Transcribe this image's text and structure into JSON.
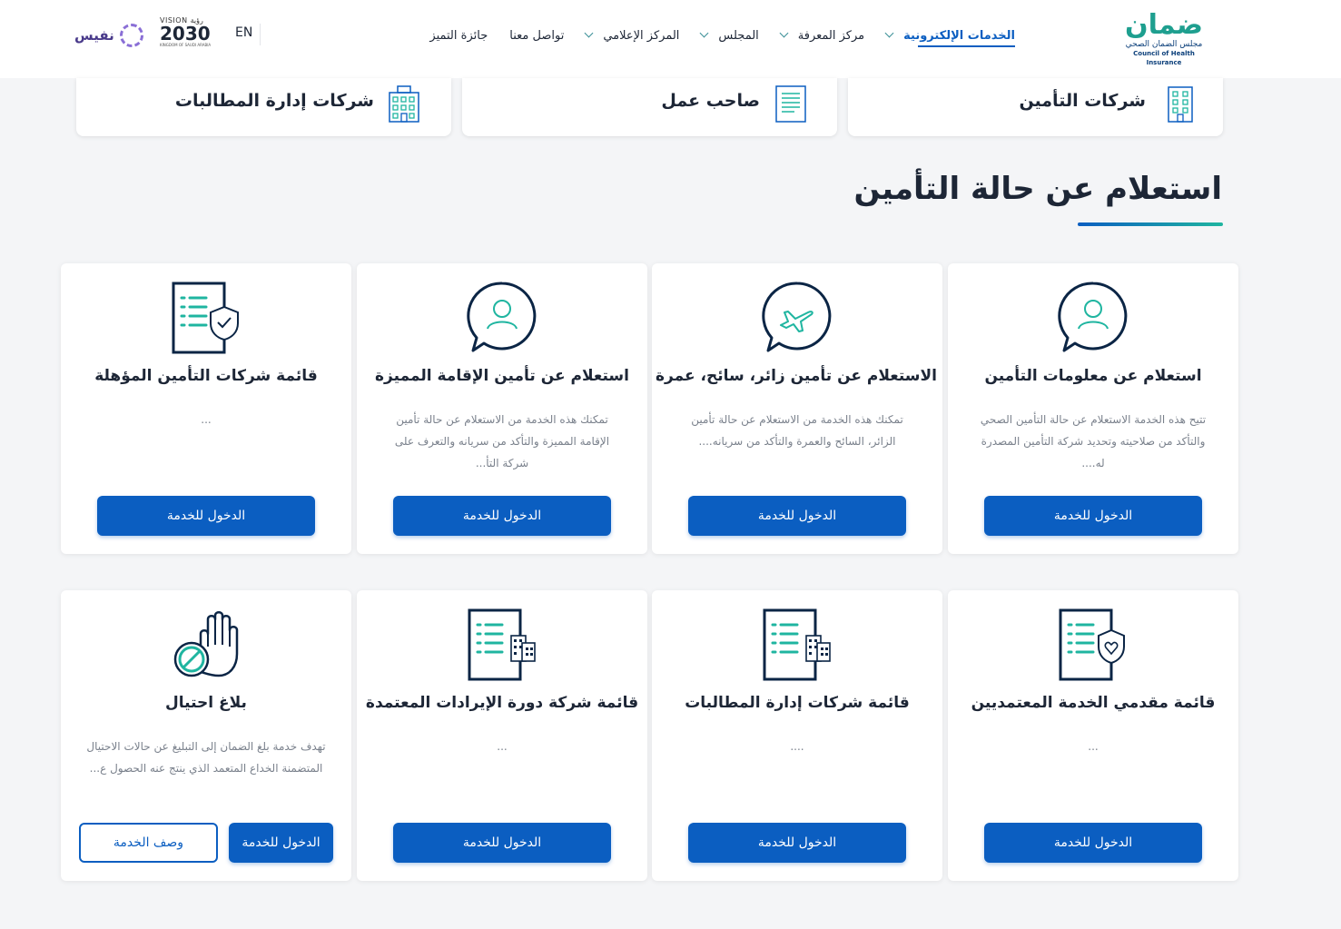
{
  "header": {
    "logo": {
      "arabic": "ضمان",
      "arabic_sub": "مجلس الضمان الصحي",
      "english": "Council of Health Insurance"
    },
    "nav": [
      {
        "label": "الخدمات الإلكترونية",
        "has_dropdown": true,
        "active": true
      },
      {
        "label": "مركز المعرفة",
        "has_dropdown": true,
        "active": false
      },
      {
        "label": "المجلس",
        "has_dropdown": true,
        "active": false
      },
      {
        "label": "المركز الإعلامي",
        "has_dropdown": true,
        "active": false
      },
      {
        "label": "تواصل معنا",
        "has_dropdown": false,
        "active": false
      },
      {
        "label": "جائزة التميز",
        "has_dropdown": false,
        "active": false
      }
    ],
    "lang_toggle": "EN",
    "vision": {
      "top": "VISION رؤية",
      "year": "2030",
      "sub": "KINGDOM OF SAUDI ARABIA"
    },
    "nafis": "نفيس"
  },
  "audience_cards": [
    {
      "label": "شركات التأمين",
      "icon": "building-icon"
    },
    {
      "label": "صاحب عمل",
      "icon": "document-icon"
    },
    {
      "label": "شركات إدارة المطالبات",
      "icon": "office-building-icon"
    }
  ],
  "section_title": "استعلام عن حالة التأمين",
  "services": [
    {
      "title": "استعلام عن معلومات التأمين",
      "desc": "تتيح هذه الخدمة الاستعلام عن حالة التأمين الصحي والتأكد من صلاحيته وتحديد شركة التأمين المصدرة له....",
      "button": "الدخول للخدمة",
      "icon": "user-chat-icon"
    },
    {
      "title": "الاستعلام عن تأمين زائر، سائح، عمرة",
      "desc": "تمكنك هذه الخدمة من الاستعلام عن حالة تأمين الزائر، السائح والعمرة والتأكد من سريانه....",
      "button": "الدخول للخدمة",
      "icon": "airplane-chat-icon"
    },
    {
      "title": "استعلام عن تأمين الإقامة المميزة",
      "desc": "تمكنك هذه الخدمة من الاستعلام عن حالة تأمين الإقامة المميزة والتأكد من سريانه والتعرف على شركة التأ...",
      "button": "الدخول للخدمة",
      "icon": "user-chat-icon"
    },
    {
      "title": "قائمة شركات التأمين المؤهلة",
      "desc": "...",
      "button": "الدخول للخدمة",
      "icon": "document-shield-icon"
    },
    {
      "title": "قائمة مقدمي الخدمة المعتمديين",
      "desc": "...",
      "button": "الدخول للخدمة",
      "icon": "document-heart-shield-icon"
    },
    {
      "title": "قائمة شركات إدارة المطالبات",
      "desc": "....",
      "button": "الدخول للخدمة",
      "icon": "document-building-icon"
    },
    {
      "title": "قائمة شركة دورة الإيرادات المعتمدة",
      "desc": "...",
      "button": "الدخول للخدمة",
      "icon": "document-building-icon"
    },
    {
      "title": "بلاغ احتيال",
      "desc": "تهدف خدمة بلغ الضمان إلى التبليغ عن حالات الاحتيال المتضمنة الخداع المتعمد الذي ينتج عنه الحصول ع...",
      "button": "الدخول للخدمة",
      "button2": "وصف الخدمة",
      "icon": "stop-hand-icon"
    }
  ],
  "colors": {
    "primary": "#0b5ec1",
    "teal": "#1fb5a0",
    "navy": "#0b2545",
    "text": "#1d2636"
  }
}
